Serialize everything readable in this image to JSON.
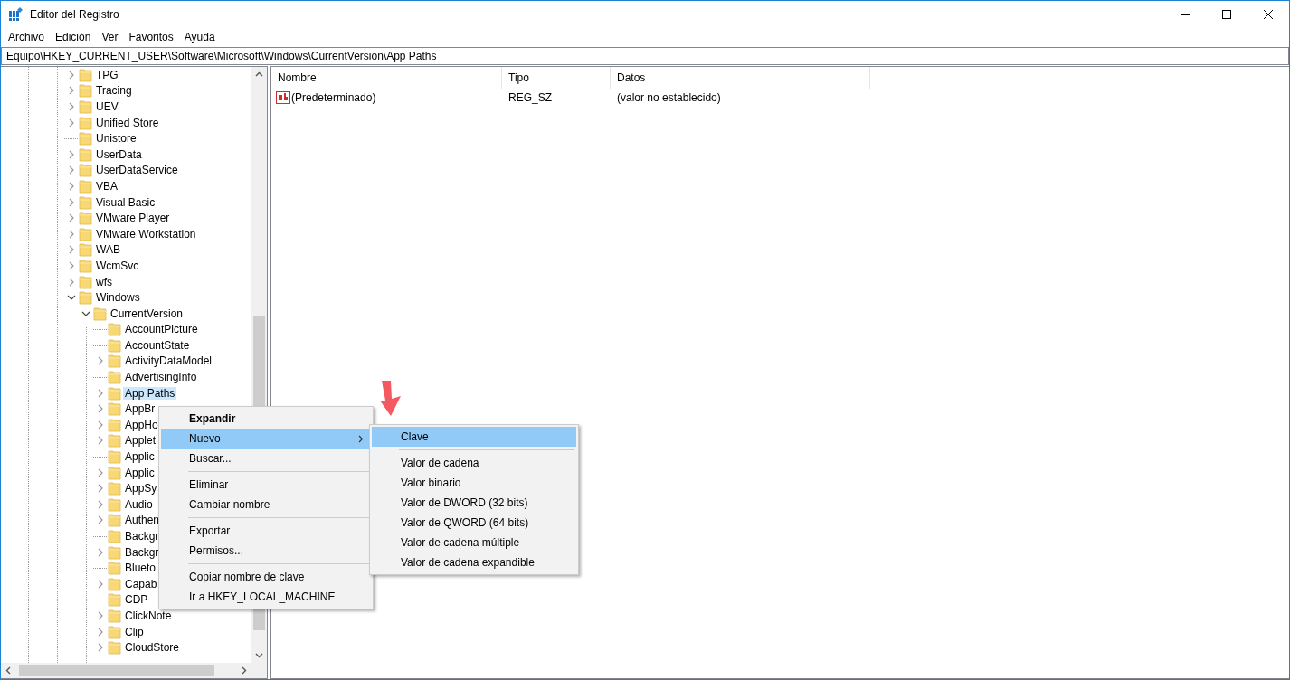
{
  "window": {
    "title": "Editor del Registro"
  },
  "menu_bar": [
    "Archivo",
    "Edición",
    "Ver",
    "Favoritos",
    "Ayuda"
  ],
  "address_bar": {
    "value": "Equipo\\HKEY_CURRENT_USER\\Software\\Microsoft\\Windows\\CurrentVersion\\App Paths"
  },
  "tree": {
    "items": [
      {
        "label": "TPG",
        "expandable": true,
        "expanded": false,
        "selected": false
      },
      {
        "label": "Tracing",
        "expandable": true,
        "expanded": false,
        "selected": false
      },
      {
        "label": "UEV",
        "expandable": true,
        "expanded": false,
        "selected": false
      },
      {
        "label": "Unified Store",
        "expandable": true,
        "expanded": false,
        "selected": false
      },
      {
        "label": "Unistore",
        "expandable": false,
        "selected": false
      },
      {
        "label": "UserData",
        "expandable": true,
        "expanded": false,
        "selected": false
      },
      {
        "label": "UserDataService",
        "expandable": true,
        "expanded": false,
        "selected": false
      },
      {
        "label": "VBA",
        "expandable": true,
        "expanded": false,
        "selected": false
      },
      {
        "label": "Visual Basic",
        "expandable": true,
        "expanded": false,
        "selected": false
      },
      {
        "label": "VMware Player",
        "expandable": true,
        "expanded": false,
        "selected": false
      },
      {
        "label": "VMware Workstation",
        "expandable": true,
        "expanded": false,
        "selected": false
      },
      {
        "label": "WAB",
        "expandable": true,
        "expanded": false,
        "selected": false
      },
      {
        "label": "WcmSvc",
        "expandable": true,
        "expanded": false,
        "selected": false
      },
      {
        "label": "wfs",
        "expandable": true,
        "expanded": false,
        "selected": false
      },
      {
        "label": "Windows",
        "expandable": true,
        "expanded": true,
        "selected": false,
        "children": [
          {
            "label": "CurrentVersion",
            "expandable": true,
            "expanded": true,
            "selected": false,
            "children": [
              {
                "label": "AccountPicture",
                "expandable": false,
                "selected": false
              },
              {
                "label": "AccountState",
                "expandable": false,
                "selected": false
              },
              {
                "label": "ActivityDataModel",
                "expandable": true,
                "expanded": false,
                "selected": false
              },
              {
                "label": "AdvertisingInfo",
                "expandable": false,
                "selected": false
              },
              {
                "label": "App Paths",
                "expandable": true,
                "expanded": false,
                "selected": true
              },
              {
                "label": "AppBr",
                "expandable": true,
                "expanded": false,
                "selected": false
              },
              {
                "label": "AppHo",
                "expandable": true,
                "expanded": false,
                "selected": false
              },
              {
                "label": "Applet",
                "expandable": true,
                "expanded": false,
                "selected": false
              },
              {
                "label": "Applic",
                "expandable": false,
                "selected": false
              },
              {
                "label": "Applic",
                "expandable": true,
                "expanded": false,
                "selected": false
              },
              {
                "label": "AppSy",
                "expandable": true,
                "expanded": false,
                "selected": false
              },
              {
                "label": "Audio",
                "expandable": true,
                "expanded": false,
                "selected": false
              },
              {
                "label": "Authen",
                "expandable": true,
                "expanded": false,
                "selected": false
              },
              {
                "label": "Backgr",
                "expandable": false,
                "selected": false
              },
              {
                "label": "Backgr",
                "expandable": true,
                "expanded": false,
                "selected": false
              },
              {
                "label": "Blueto",
                "expandable": false,
                "selected": false
              },
              {
                "label": "Capab",
                "expandable": true,
                "expanded": false,
                "selected": false
              },
              {
                "label": "CDP",
                "expandable": false,
                "selected": false
              },
              {
                "label": "ClickNote",
                "expandable": true,
                "expanded": false,
                "selected": false
              },
              {
                "label": "Clip",
                "expandable": true,
                "expanded": false,
                "selected": false
              },
              {
                "label": "CloudStore",
                "expandable": true,
                "expanded": false,
                "selected": false
              }
            ]
          }
        ]
      }
    ]
  },
  "values_table": {
    "columns": [
      "Nombre",
      "Tipo",
      "Datos"
    ],
    "rows": [
      {
        "name": "(Predeterminado)",
        "type": "REG_SZ",
        "data": "(valor no establecido)"
      }
    ]
  },
  "context_menu": {
    "items": [
      {
        "kind": "item",
        "label": "Expandir",
        "default": true,
        "selected": false,
        "has_submenu": false
      },
      {
        "kind": "item",
        "label": "Nuevo",
        "default": false,
        "selected": true,
        "has_submenu": true
      },
      {
        "kind": "item",
        "label": "Buscar...",
        "default": false,
        "selected": false,
        "has_submenu": false
      },
      {
        "kind": "separator"
      },
      {
        "kind": "item",
        "label": "Eliminar",
        "default": false,
        "selected": false,
        "has_submenu": false
      },
      {
        "kind": "item",
        "label": "Cambiar nombre",
        "default": false,
        "selected": false,
        "has_submenu": false
      },
      {
        "kind": "separator"
      },
      {
        "kind": "item",
        "label": "Exportar",
        "default": false,
        "selected": false,
        "has_submenu": false
      },
      {
        "kind": "item",
        "label": "Permisos...",
        "default": false,
        "selected": false,
        "has_submenu": false
      },
      {
        "kind": "separator"
      },
      {
        "kind": "item",
        "label": "Copiar nombre de clave",
        "default": false,
        "selected": false,
        "has_submenu": false
      },
      {
        "kind": "item",
        "label": "Ir a HKEY_LOCAL_MACHINE",
        "default": false,
        "selected": false,
        "has_submenu": false
      }
    ]
  },
  "submenu": {
    "items": [
      {
        "kind": "item",
        "label": "Clave",
        "selected": true
      },
      {
        "kind": "separator"
      },
      {
        "kind": "item",
        "label": "Valor de cadena",
        "selected": false
      },
      {
        "kind": "item",
        "label": "Valor binario",
        "selected": false
      },
      {
        "kind": "item",
        "label": "Valor de DWORD (32 bits)",
        "selected": false
      },
      {
        "kind": "item",
        "label": "Valor de QWORD (64 bits)",
        "selected": false
      },
      {
        "kind": "item",
        "label": "Valor de cadena múltiple",
        "selected": false
      },
      {
        "kind": "item",
        "label": "Valor de cadena expandible",
        "selected": false
      }
    ]
  }
}
